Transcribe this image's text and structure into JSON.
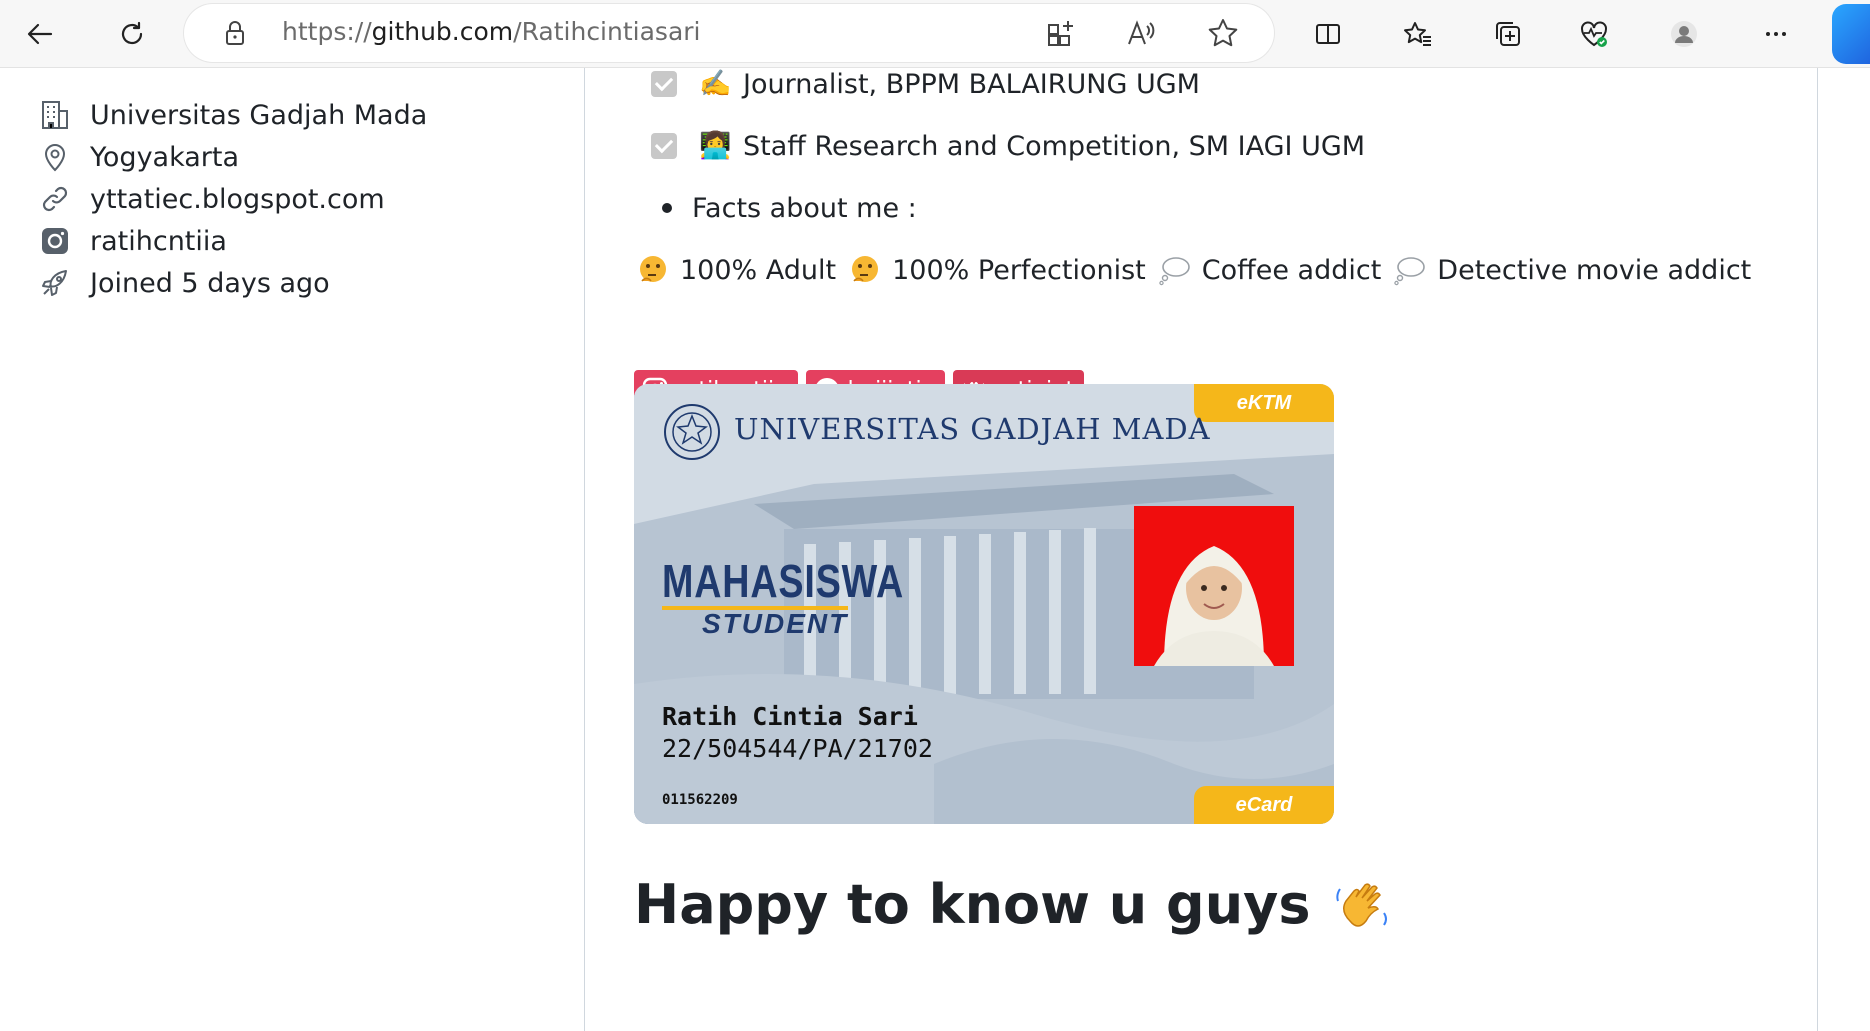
{
  "browser": {
    "url_prefix": "https://",
    "url_host": "github.com",
    "url_path": "/Ratihcintiasari"
  },
  "sidebar": {
    "items": [
      {
        "icon": "organization-icon",
        "label": "Universitas Gadjah Mada"
      },
      {
        "icon": "location-icon",
        "label": "Yogyakarta"
      },
      {
        "icon": "link-icon",
        "label": "yttatiec.blogspot.com"
      },
      {
        "icon": "instagram-icon",
        "label": "ratihcntiia"
      },
      {
        "icon": "rocket-icon",
        "label": "Joined 5 days ago"
      }
    ]
  },
  "readme": {
    "tasks": [
      {
        "emoji": "✍️",
        "label": "Journalist, BPPM BALAIRUNG UGM"
      },
      {
        "emoji": "👩‍💻",
        "label": "Staff Research and Competition, SM IAGI UGM"
      }
    ],
    "bullet": "Facts about me :",
    "facts": [
      {
        "icon": "thinking-face-icon",
        "label": "100% Adult"
      },
      {
        "icon": "thinking-face-icon",
        "label": "100% Perfectionist"
      },
      {
        "icon": "thought-balloon-icon",
        "label": "Coffee addict"
      },
      {
        "icon": "thought-balloon-icon",
        "label": "Detective movie addict"
      }
    ],
    "badges": [
      {
        "icon": "instagram-icon",
        "label": "ratihcntiia",
        "color": "#e4405f"
      },
      {
        "icon": "spotify-icon",
        "label": "heijiatie",
        "color": "#e4405f"
      },
      {
        "icon": "wattpad-icon",
        "label": "ratiejat",
        "color": "#d93a56"
      }
    ],
    "card": {
      "tag_top": "eKTM",
      "tag_bottom": "eCard",
      "university": "UNIVERSITAS GADJAH MADA",
      "role": "MAHASISWA",
      "role_en": "STUDENT",
      "name": "Ratih Cintia Sari",
      "id": "22/504544/PA/21702",
      "code": "011562209"
    },
    "heading": "Happy to know u guys"
  },
  "colors": {
    "badge": "#e4405f",
    "card_tag": "#f5b71a",
    "photo_bg": "#f00d0d",
    "navy": "#1f3a6e"
  }
}
